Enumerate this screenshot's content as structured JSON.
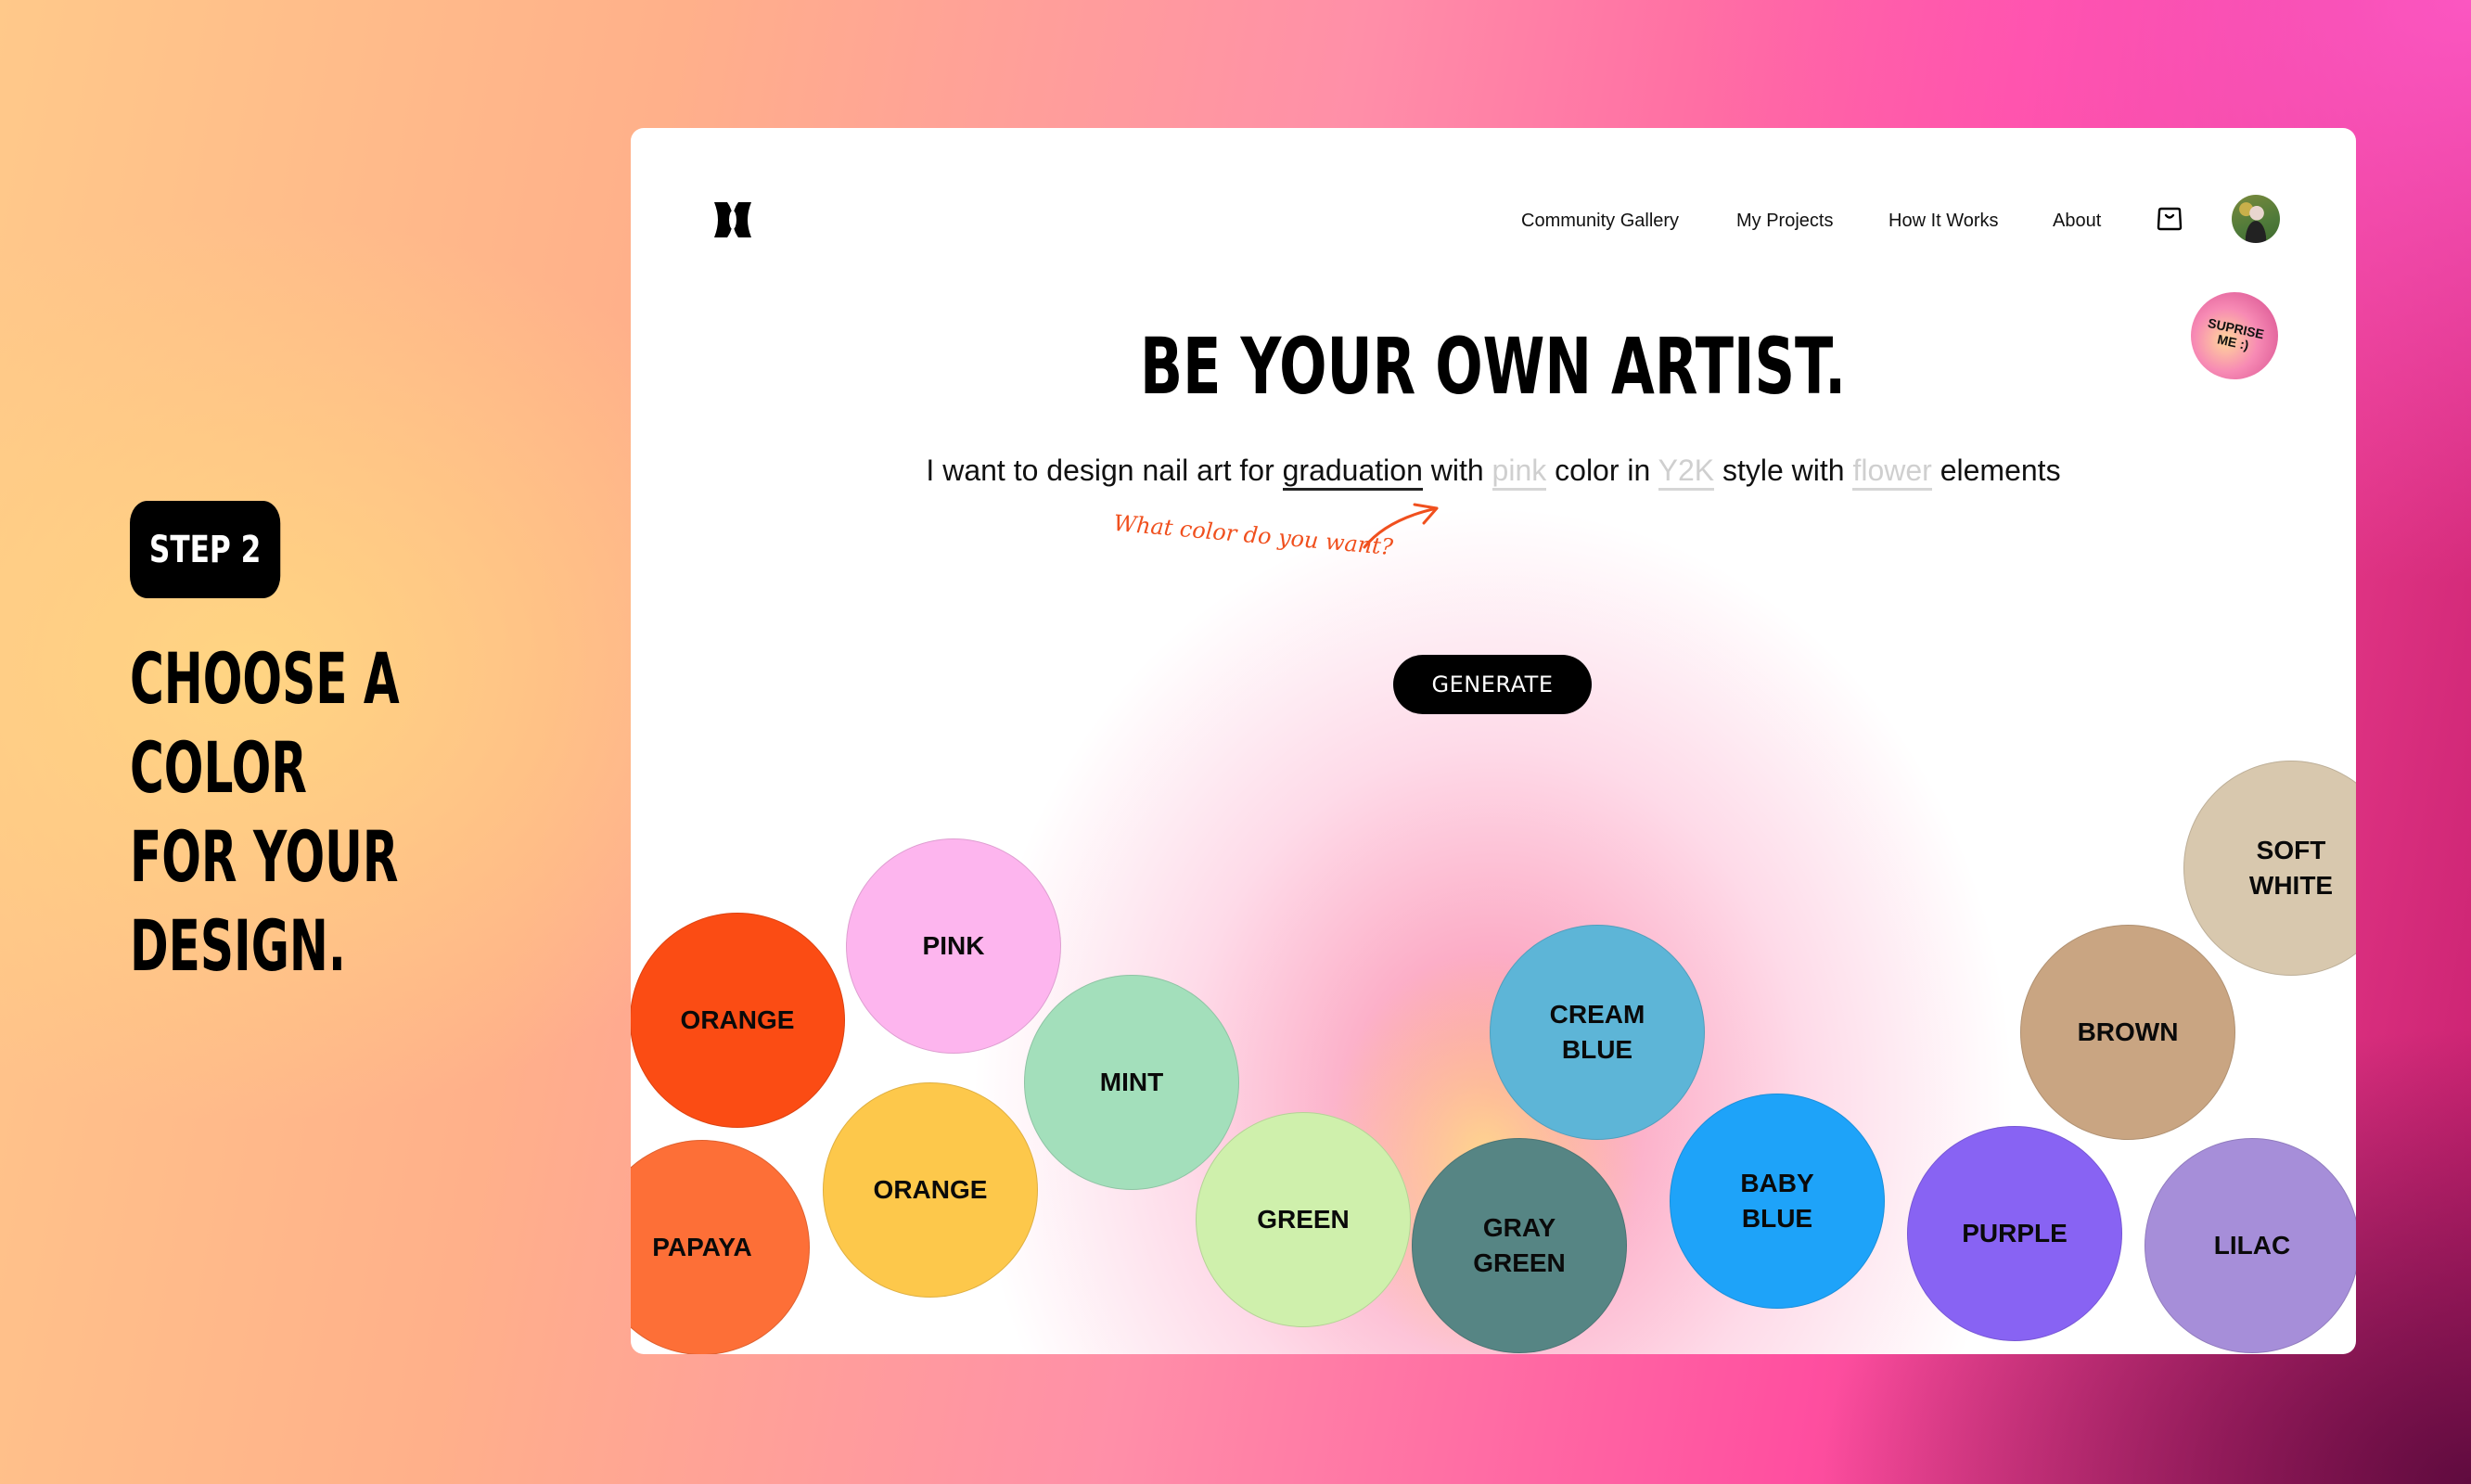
{
  "step": {
    "label": "STEP 2",
    "heading_line1": "CHOOSE A COLOR",
    "heading_line2": "FOR YOUR DESIGN."
  },
  "nav": {
    "items": [
      "Community Gallery",
      "My Projects",
      "How It Works",
      "About"
    ],
    "cart_icon": "shopping-bag-icon",
    "avatar_icon": "user-avatar"
  },
  "surprise_button": {
    "label": "SUPRISE ME :)"
  },
  "hero": {
    "title": "BE YOUR OWN ARTIST.",
    "prompt": {
      "part1": "I want to design nail art for ",
      "occasion": "graduation",
      "part2": " with ",
      "color": "pink",
      "part3": " color in ",
      "style": "Y2K",
      "part4": " style with ",
      "element": "flower",
      "part5": " elements"
    },
    "annotation": "What color do you want?",
    "generate_label": "GENERATE"
  },
  "swatches": [
    {
      "label": "ORANGE",
      "color": "#fb4c14"
    },
    {
      "label": "PINK",
      "color": "#fdb5ee"
    },
    {
      "label": "MINT",
      "color": "#a3dfbb"
    },
    {
      "label": "ORANGE",
      "color": "#fdc84b"
    },
    {
      "label": "PAPAYA",
      "color": "#fd6f37"
    },
    {
      "label": "GREEN",
      "color": "#cff0ac"
    },
    {
      "label": "GRAY GREEN",
      "color": "#568584"
    },
    {
      "label": "CREAM BLUE",
      "color": "#5db5d7"
    },
    {
      "label": "BABY BLUE",
      "color": "#1ea3f9"
    },
    {
      "label": "PURPLE",
      "color": "#8863f3"
    },
    {
      "label": "LILAC",
      "color": "#a68ed9"
    },
    {
      "label": "BROWN",
      "color": "#c9a582"
    },
    {
      "label": "SOFT WHITE",
      "color": "#d8c8ae"
    }
  ],
  "colors": {
    "accent": "#000000",
    "annotation": "#f0501e",
    "placeholder": "#cfcfcf"
  }
}
